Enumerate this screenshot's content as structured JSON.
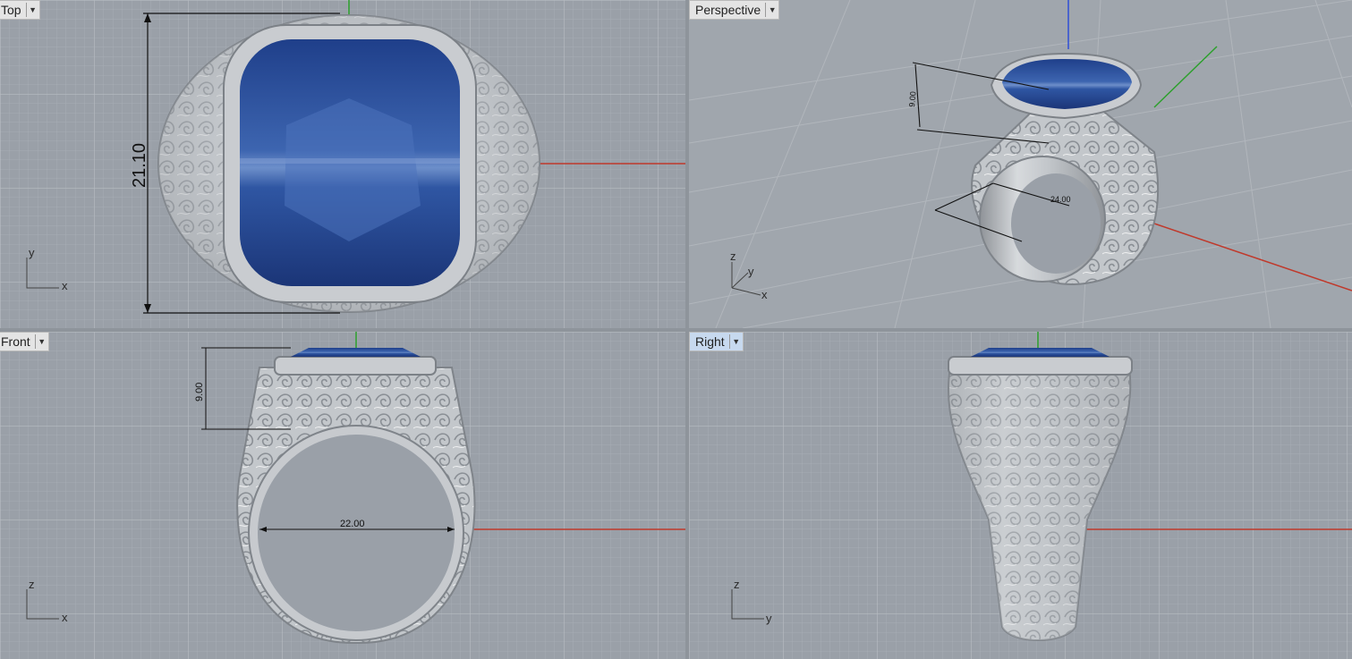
{
  "viewports": {
    "top": {
      "label": "Top",
      "dimension": "21.10",
      "axes": [
        "y",
        "x"
      ]
    },
    "perspective": {
      "label": "Perspective",
      "dimensions": [
        "9.00",
        "24.00"
      ],
      "axes": [
        "z",
        "y",
        "x"
      ]
    },
    "front": {
      "label": "Front",
      "dimensions": [
        "9.00",
        "22.00"
      ],
      "axes": [
        "z",
        "x"
      ]
    },
    "right": {
      "label": "Right",
      "axes": [
        "z",
        "y"
      ]
    }
  },
  "colors": {
    "background": "#9aa0a8",
    "grid": "#aeb3ba",
    "x_axis": "#c0392b",
    "y_axis": "#2ca02c",
    "z_axis": "#2f4fd6",
    "metal": "#c8cbcf",
    "gem": "#2b4f9e"
  },
  "icons": {
    "viewport_menu": "dropdown-arrow-icon"
  }
}
